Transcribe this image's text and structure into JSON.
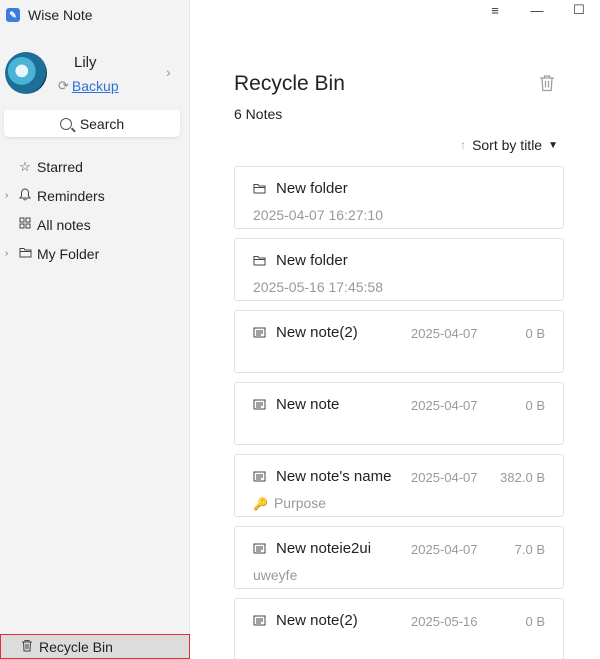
{
  "app": {
    "name": "Wise Note",
    "logo": "wise-note-logo"
  },
  "window_controls": {
    "menu": "≡",
    "minimize": "—",
    "maximize": "☐"
  },
  "profile": {
    "username": "Lily",
    "backup_label": "Backup"
  },
  "search": {
    "label": "Search"
  },
  "nav": {
    "starred": "Starred",
    "reminders": "Reminders",
    "all_notes": "All notes",
    "my_folder": "My Folder",
    "recycle_bin": "Recycle Bin"
  },
  "main": {
    "title": "Recycle Bin",
    "count": "6 Notes",
    "sort_label": "Sort by title"
  },
  "cards": [
    {
      "type": "folder",
      "title": "New folder",
      "subtitle": "2025-04-07 16:27:10"
    },
    {
      "type": "folder",
      "title": "New folder",
      "subtitle": "2025-05-16 17:45:58"
    },
    {
      "type": "note",
      "title": "New note(2)",
      "date": "2025-04-07",
      "size": "0 B",
      "subtitle": ""
    },
    {
      "type": "note",
      "title": "New note",
      "date": "2025-04-07",
      "size": "0 B",
      "subtitle": ""
    },
    {
      "type": "note",
      "title": "New note's name",
      "date": "2025-04-07",
      "size": "382.0 B",
      "subtitle": "Purpose",
      "locked": true
    },
    {
      "type": "note",
      "title": "New noteie2ui",
      "date": "2025-04-07",
      "size": "7.0 B",
      "subtitle": "uweyfe"
    },
    {
      "type": "note",
      "title": "New note(2)",
      "date": "2025-05-16",
      "size": "0 B",
      "subtitle": ""
    }
  ],
  "colors": {
    "accent": "#2f6fd6",
    "highlight_border": "#e03030",
    "sidebar_bg": "#f3f3f3"
  }
}
